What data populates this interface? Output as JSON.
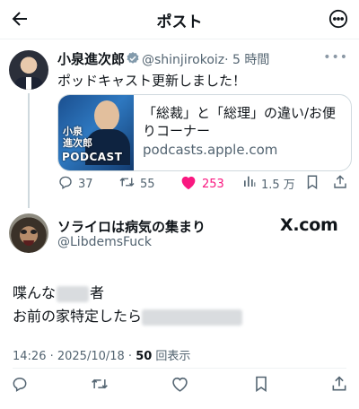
{
  "header": {
    "title": "ポスト",
    "back_icon": "arrow-left-icon",
    "more_icon": "more-horizontal-icon"
  },
  "parent_post": {
    "name": "小泉進次郎",
    "handle": "@shinjirokoiz",
    "time": "· 5 時間",
    "text": "ポッドキャスト更新しました！",
    "card": {
      "image_label_line1": "小泉",
      "image_label_line2": "進次郎",
      "image_label_line3": "PODCAST",
      "title": "「総裁」と「総理」の違い/お便りコーナー",
      "domain": "podcasts.apple.com"
    },
    "actions": {
      "replies": "37",
      "reposts": "55",
      "likes": "253",
      "views": "1.5 万"
    },
    "like_color": "#f91880"
  },
  "reply_post": {
    "name": "ソライロは病気の集まり",
    "handle": "@LibdemsFuck",
    "watermark": "X.com",
    "line1_prefix": "喋んな",
    "line1_suffix": "者",
    "line2_prefix": "お前の家特定したら",
    "timestamp": "14:26 · 2025/10/18 · ",
    "views_count": "50",
    "views_label": " 回表示"
  },
  "action_bar": [
    "reply-icon",
    "repost-icon",
    "like-icon",
    "bookmark-icon",
    "share-icon"
  ],
  "colors": {
    "text": "#0f1419",
    "secondary": "#536471",
    "verified": "#829aab",
    "divider": "#eff3f4"
  }
}
